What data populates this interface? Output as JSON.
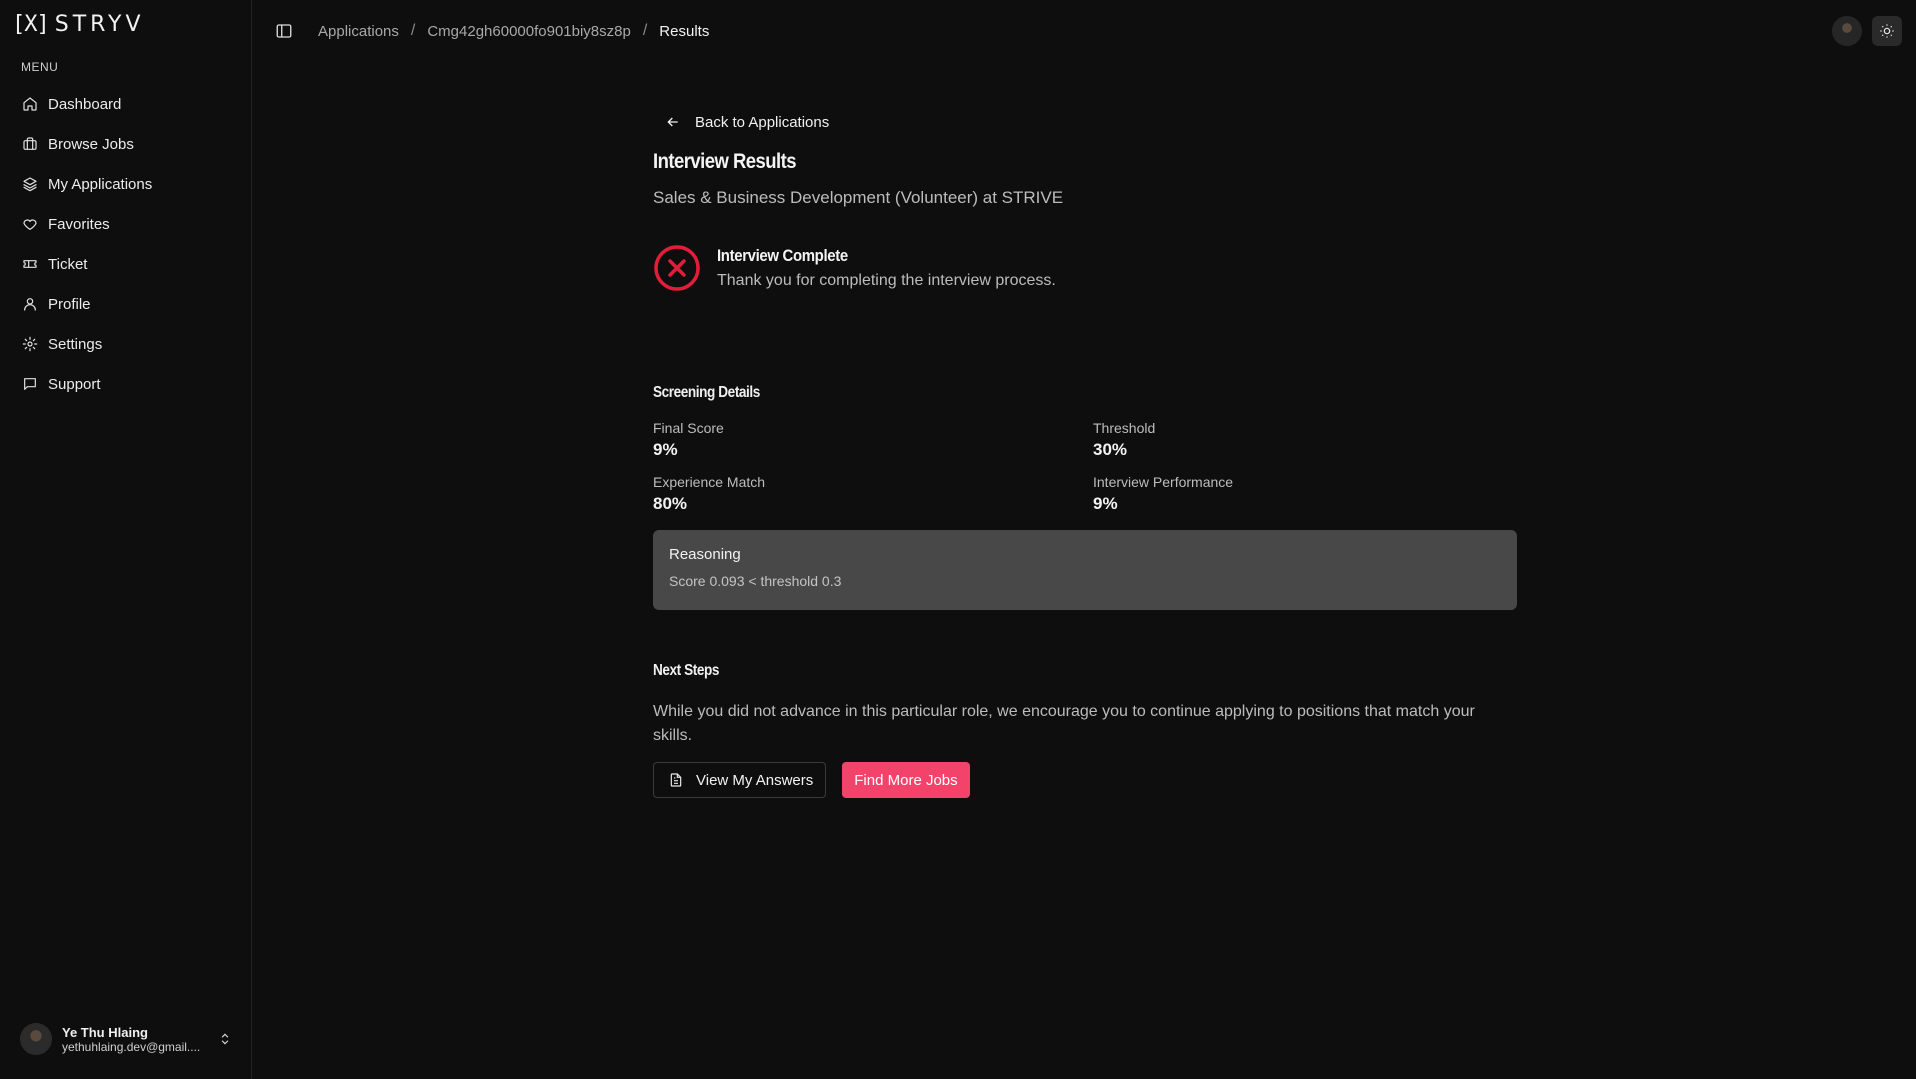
{
  "app": {
    "logo_mark": "[X]",
    "logo_word": "STRYV"
  },
  "sidebar": {
    "menu_label": "MENU",
    "items": [
      {
        "label": "Dashboard",
        "icon": "home-icon"
      },
      {
        "label": "Browse Jobs",
        "icon": "briefcase-icon"
      },
      {
        "label": "My Applications",
        "icon": "layers-icon"
      },
      {
        "label": "Favorites",
        "icon": "heart-icon"
      },
      {
        "label": "Ticket",
        "icon": "ticket-icon"
      },
      {
        "label": "Profile",
        "icon": "user-icon"
      },
      {
        "label": "Settings",
        "icon": "gear-icon"
      },
      {
        "label": "Support",
        "icon": "message-icon"
      }
    ],
    "user": {
      "name": "Ye Thu Hlaing",
      "email": "yethuhlaing.dev@gmail...."
    }
  },
  "breadcrumb": {
    "items": [
      "Applications",
      "Cmg42gh60000fo901biy8sz8p",
      "Results"
    ]
  },
  "main": {
    "back_label": "Back to Applications",
    "title": "Interview Results",
    "subtitle": "Sales & Business Development (Volunteer) at STRIVE",
    "status": {
      "title": "Interview Complete",
      "text": "Thank you for completing the interview process.",
      "icon": "x-circle-icon"
    },
    "screening": {
      "title": "Screening Details",
      "metrics": [
        {
          "label": "Final Score",
          "value": "9%"
        },
        {
          "label": "Threshold",
          "value": "30%"
        },
        {
          "label": "Experience Match",
          "value": "80%"
        },
        {
          "label": "Interview Performance",
          "value": "9%"
        }
      ],
      "reasoning_title": "Reasoning",
      "reasoning_text": "Score 0.093 < threshold 0.3"
    },
    "next_steps": {
      "title": "Next Steps",
      "text": "While you did not advance in this particular role, we encourage you to continue applying to positions that match your skills.",
      "view_answers_label": "View My Answers",
      "find_jobs_label": "Find More Jobs"
    }
  },
  "colors": {
    "background": "#0e0e0e",
    "accent": "#f4436b",
    "error": "#e11d3a",
    "card": "#484848"
  }
}
